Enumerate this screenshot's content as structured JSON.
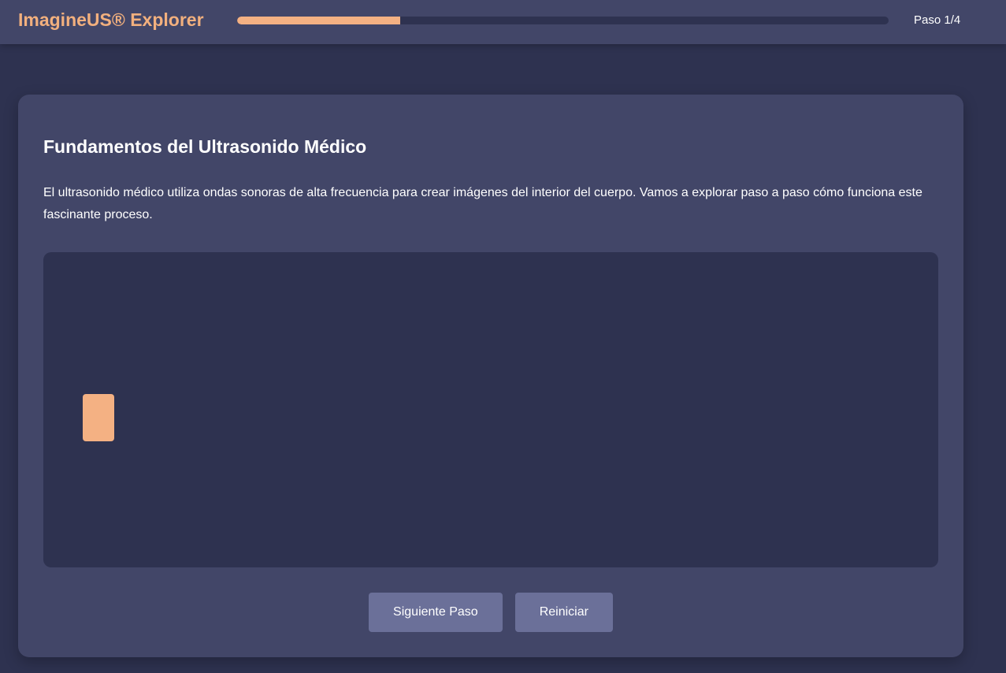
{
  "header": {
    "brand": "ImagineUS® Explorer",
    "progress_fraction": 0.25,
    "step_label": "Paso 1/4"
  },
  "lesson": {
    "title": "Fundamentos del Ultrasonido Médico",
    "description": "El ultrasonido médico utiliza ondas sonoras de alta frecuencia para crear imágenes del interior del cuerpo. Vamos a explorar paso a paso cómo funciona este fascinante proceso."
  },
  "controls": {
    "next_label": "Siguiente Paso",
    "reset_label": "Reiniciar"
  },
  "colors": {
    "background": "#2e3250",
    "panel": "#424668",
    "accent": "#f4b183",
    "button": "#6b7099"
  }
}
